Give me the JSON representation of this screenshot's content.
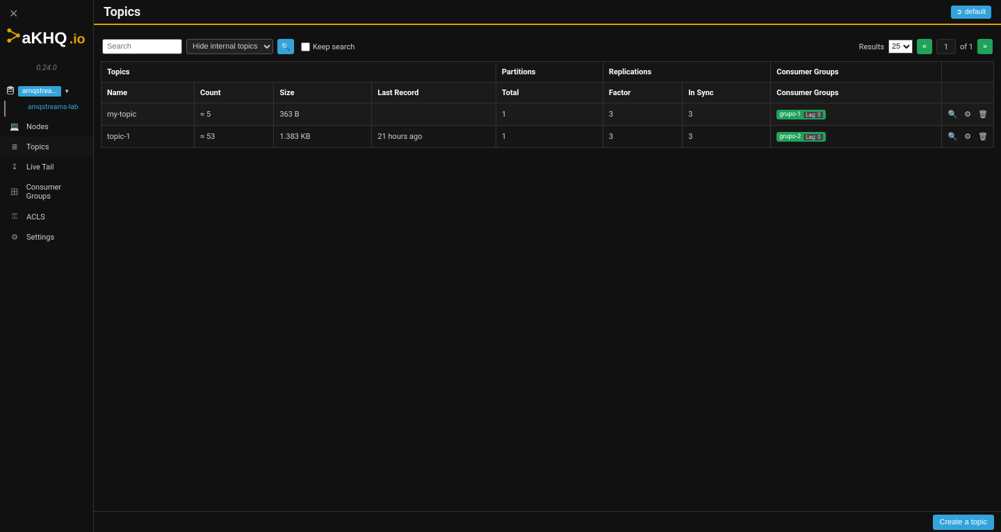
{
  "app": {
    "version": "0.24.0",
    "title": "Topics",
    "login_label": "default"
  },
  "sidebar": {
    "cluster_badge": "amqstrea...",
    "cluster_full": "amqstreams-lab",
    "nav": [
      {
        "label": "Nodes",
        "icon": "laptop"
      },
      {
        "label": "Topics",
        "icon": "list"
      },
      {
        "label": "Live Tail",
        "icon": "level"
      },
      {
        "label": "Consumer Groups",
        "icon": "group"
      },
      {
        "label": "ACLS",
        "icon": "key"
      },
      {
        "label": "Settings",
        "icon": "gear"
      }
    ]
  },
  "toolbar": {
    "search_placeholder": "Search",
    "filter_options": [
      "Hide internal topics"
    ],
    "filter_selected": "Hide internal topics",
    "keep_search_label": "Keep search",
    "results_label": "Results",
    "results_options": [
      "25"
    ],
    "results_selected": "25",
    "page_current": "1",
    "page_of": "of 1"
  },
  "table": {
    "group_headers": [
      "Topics",
      "Partitions",
      "Replications",
      "Consumer Groups",
      ""
    ],
    "columns": [
      "Name",
      "Count",
      "Size",
      "Last Record",
      "Total",
      "Factor",
      "In Sync",
      "Consumer Groups",
      ""
    ],
    "rows": [
      {
        "name": "my-topic",
        "count": "≈ 5",
        "size": "363 B",
        "last_record": "",
        "total": "1",
        "factor": "3",
        "insync": "3",
        "cg_name": "grupo-1",
        "cg_lag": "Lag: 0"
      },
      {
        "name": "topic-1",
        "count": "≈ 53",
        "size": "1.383 KB",
        "last_record": "21 hours ago",
        "total": "1",
        "factor": "3",
        "insync": "3",
        "cg_name": "grupo-2",
        "cg_lag": "Lag: 0"
      }
    ]
  },
  "footer": {
    "create_label": "Create a topic"
  }
}
